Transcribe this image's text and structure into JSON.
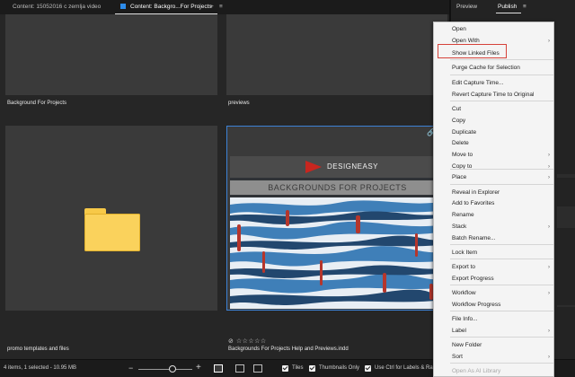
{
  "tabs": [
    {
      "label": "Content: 15052016 c zemlja video"
    },
    {
      "label": "Content: Backgro...For Projects"
    }
  ],
  "tab_actions": {
    "add": "+",
    "menu": "≡"
  },
  "right_panel": {
    "tabs": [
      {
        "label": "Preview"
      },
      {
        "label": "Publish"
      }
    ],
    "menu": "≡"
  },
  "items": [
    {
      "label": "Background For Projects"
    },
    {
      "label": "previews"
    },
    {
      "label": "promo templates and files"
    },
    {
      "label": "Backgrounds For Projects Help and Previews.indd",
      "rating": "☆☆☆☆☆",
      "reject": "⊘"
    }
  ],
  "thumbnail": {
    "logo_text": "DESIGNEASY",
    "banner_text": "BACKGROUNDS FOR PROJECTS"
  },
  "status": {
    "summary": "4 items, 1 selected - 10.95 MB",
    "zoom_minus": "−",
    "zoom_plus": "+",
    "zoom_level": 0.64,
    "tiles_label": "Tiles",
    "thumbnails_only_label": "Thumbnails Only",
    "ctrl_label": "Use Ctrl for Labels & Rati"
  },
  "context_menu": {
    "items": [
      {
        "label": "Open",
        "submenu": false
      },
      {
        "label": "Open With",
        "submenu": true
      },
      {
        "label": "Show Linked Files",
        "submenu": false,
        "highlighted": true
      },
      {
        "label": "Purge Cache for Selection",
        "submenu": false
      },
      {
        "label": "Edit Capture Time...",
        "submenu": false
      },
      {
        "label": "Revert Capture Time to Original",
        "submenu": false
      },
      {
        "label": "Cut",
        "submenu": false
      },
      {
        "label": "Copy",
        "submenu": false
      },
      {
        "label": "Duplicate",
        "submenu": false
      },
      {
        "label": "Delete",
        "submenu": false
      },
      {
        "label": "Move to",
        "submenu": true
      },
      {
        "label": "Copy to",
        "submenu": true
      },
      {
        "label": "Place",
        "submenu": true
      },
      {
        "label": "Reveal in Explorer",
        "submenu": false
      },
      {
        "label": "Add to Favorites",
        "submenu": false
      },
      {
        "label": "Rename",
        "submenu": false
      },
      {
        "label": "Stack",
        "submenu": true
      },
      {
        "label": "Batch Rename...",
        "submenu": false
      },
      {
        "label": "Lock Item",
        "submenu": false
      },
      {
        "label": "Export to",
        "submenu": true
      },
      {
        "label": "Export Progress",
        "submenu": false
      },
      {
        "label": "Workflow",
        "submenu": true
      },
      {
        "label": "Workflow Progress",
        "submenu": false
      },
      {
        "label": "File Info...",
        "submenu": false
      },
      {
        "label": "Label",
        "submenu": true
      },
      {
        "label": "New Folder",
        "submenu": false
      },
      {
        "label": "Sort",
        "submenu": true
      },
      {
        "label": "Open As AI Library",
        "submenu": false,
        "disabled": true
      }
    ]
  },
  "colors": {
    "accent": "#3d82d6",
    "highlight_box": "#d6423a",
    "folder": "#fad25c"
  }
}
